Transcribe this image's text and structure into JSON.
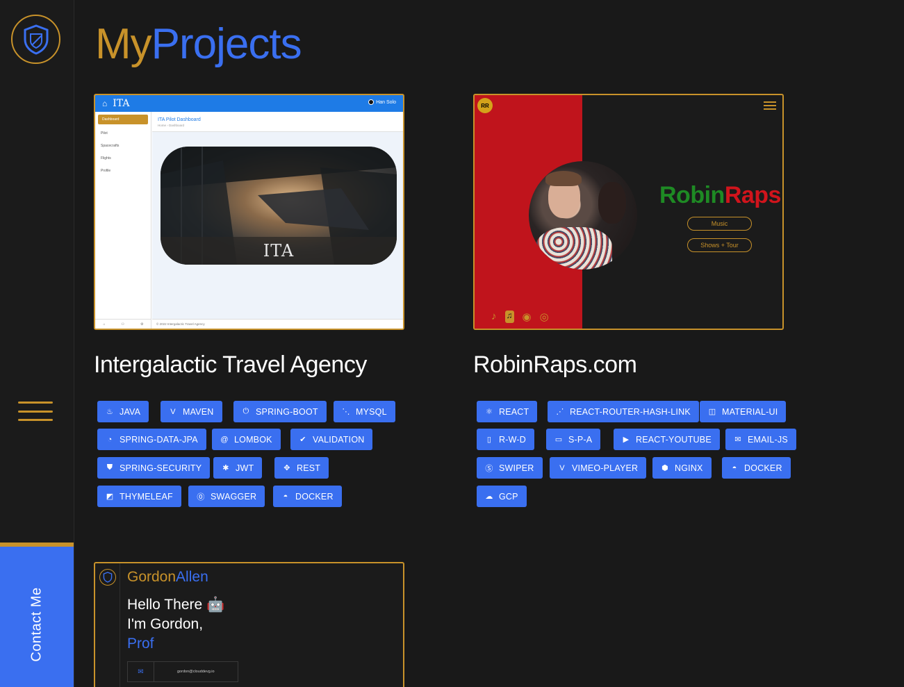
{
  "sidebar": {
    "logo_icon": "shield-icon",
    "menu_icon": "hamburger-icon",
    "contact_label": "Contact Me"
  },
  "header": {
    "title_part1": "My",
    "title_part2": "Projects"
  },
  "colors": {
    "gold": "#c8922a",
    "blue": "#3a6ff0",
    "background": "#191919"
  },
  "projects": [
    {
      "title": "Intergalactic Travel Agency",
      "preview": {
        "brand": "ITA",
        "user": "Han Solo",
        "dashboard_title": "ITA Pilot Dashboard",
        "breadcrumb": "Home  ›  Dashboard",
        "nav": [
          "Dashboard",
          "Pilot",
          "Spacecrafts",
          "Flights",
          "Profile"
        ],
        "hero_label": "ITA",
        "footer": "© 2022 Intergalactic Travel Agency"
      },
      "tags": [
        {
          "label": "JAVA",
          "icon": "java-icon"
        },
        {
          "label": "MAVEN",
          "icon": "maven-icon"
        },
        {
          "label": "SPRING-BOOT",
          "icon": "spring-boot-icon"
        },
        {
          "label": "MYSQL",
          "icon": "mysql-icon"
        },
        {
          "label": "SPRING-DATA-JPA",
          "icon": "spring-data-icon"
        },
        {
          "label": "LOMBOK",
          "icon": "at-icon"
        },
        {
          "label": "VALIDATION",
          "icon": "check-icon"
        },
        {
          "label": "SPRING-SECURITY",
          "icon": "shield-icon"
        },
        {
          "label": "JWT",
          "icon": "gear-icon"
        },
        {
          "label": "REST",
          "icon": "arrows-icon"
        },
        {
          "label": "THYMELEAF",
          "icon": "edit-icon"
        },
        {
          "label": "SWAGGER",
          "icon": "swagger-icon"
        },
        {
          "label": "DOCKER",
          "icon": "docker-icon"
        }
      ]
    },
    {
      "title": "RobinRaps.com",
      "preview": {
        "logo": "RR",
        "brand_part1": "Robin",
        "brand_part2": "Raps",
        "button1": "Music",
        "button2": "Shows + Tour",
        "socials": [
          "tiktok-icon",
          "music-icon",
          "spotify-icon",
          "instagram-icon"
        ]
      },
      "tags": [
        {
          "label": "REACT",
          "icon": "react-icon"
        },
        {
          "label": "REACT-ROUTER-HASH-LINK",
          "icon": "router-icon"
        },
        {
          "label": "MATERIAL-UI",
          "icon": "material-icon"
        },
        {
          "label": "R-W-D",
          "icon": "devices-icon"
        },
        {
          "label": "S-P-A",
          "icon": "bookmark-icon"
        },
        {
          "label": "REACT-YOUTUBE",
          "icon": "youtube-icon"
        },
        {
          "label": "EMAIL-JS",
          "icon": "mail-icon"
        },
        {
          "label": "SWIPER",
          "icon": "swiper-icon"
        },
        {
          "label": "VIMEO-PLAYER",
          "icon": "vimeo-icon"
        },
        {
          "label": "NGINX",
          "icon": "nginx-icon"
        },
        {
          "label": "DOCKER",
          "icon": "docker-icon"
        },
        {
          "label": "GCP",
          "icon": "cloud-icon"
        }
      ]
    },
    {
      "preview": {
        "name_part1": "Gordon",
        "name_part2": "Allen",
        "hello_line1": "Hello There 🤖",
        "hello_line2": "I'm Gordon,",
        "hello_line3": "Prof",
        "email": "gordon@clouddevg.io"
      }
    }
  ]
}
